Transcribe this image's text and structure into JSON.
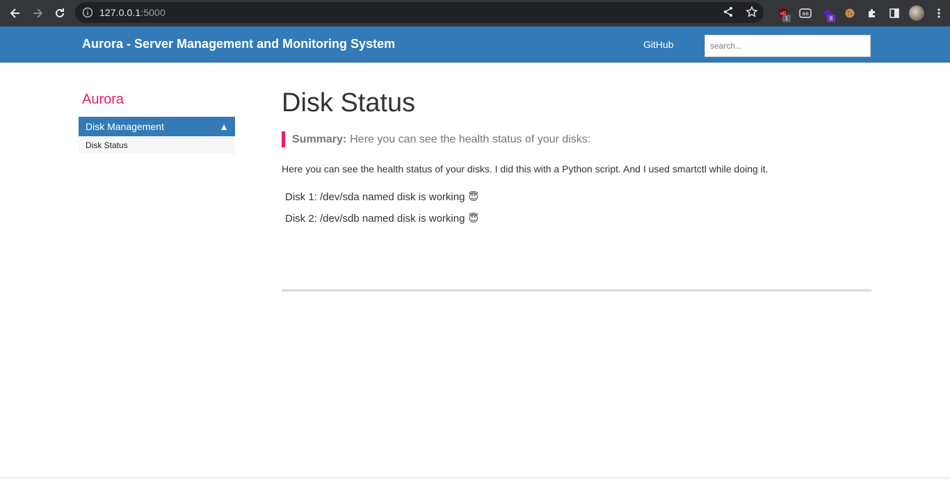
{
  "browser": {
    "url_host": "127.0.0.1",
    "url_port": ":5000",
    "extensions": [
      {
        "name": "ublock-icon",
        "badge": "1",
        "badge_color": "#5f6368"
      },
      {
        "name": "ae-extension-icon",
        "badge": ""
      },
      {
        "name": "purple-extension-icon",
        "badge": "8",
        "badge_color": "#673ab7"
      },
      {
        "name": "cookie-icon",
        "badge": ""
      }
    ]
  },
  "navbar": {
    "brand": "Aurora - Server Management and Monitoring System",
    "github_link": "GitHub",
    "search_placeholder": "search...",
    "color": "#337ab7"
  },
  "sidebar": {
    "title": "Aurora",
    "section_label": "Disk Management",
    "section_caret": "▲",
    "items": [
      {
        "label": "Disk Status"
      }
    ]
  },
  "main": {
    "title": "Disk Status",
    "summary_label": "Summary:",
    "summary_text": "Here you can see the health status of your disks:",
    "intro": "Here you can see the health status of your disks. I did this with a Python script. And I used smartctl while doing it.",
    "disks": [
      {
        "text": "Disk 1: /dev/sda named disk is working",
        "emoji": "😇"
      },
      {
        "text": "Disk 2: /dev/sdb named disk is working",
        "emoji": "😇"
      }
    ]
  },
  "colors": {
    "accent": "#e91e63",
    "primary": "#337ab7"
  }
}
